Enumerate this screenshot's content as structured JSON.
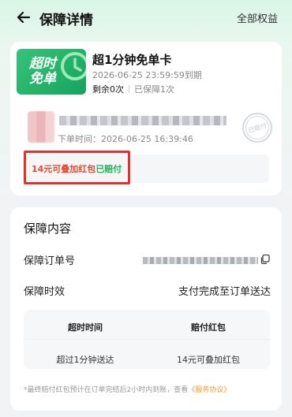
{
  "header": {
    "title": "保障详情",
    "all_benefits": "全部权益"
  },
  "card": {
    "badge_line1": "超时",
    "badge_line2": "免单",
    "name": "超1分钟免单卡",
    "expire": "2026-06-25 23:59:59到期",
    "remaining": "剩余0次",
    "used": "已保障1次"
  },
  "order": {
    "time": "下单时间：2026-06-25 16:39:46",
    "stamp": "已赔付"
  },
  "claim": {
    "amount": "14元可叠加红包",
    "status": "已赔付"
  },
  "guarantee": {
    "section_title": "保障内容",
    "order_no_label": "保障订单号",
    "timeliness_label": "保障时效",
    "timeliness_value": "支付完成至订单送达",
    "table": {
      "headers": [
        "超时时间",
        "赔付红包"
      ],
      "row": [
        "超过1分钟送达",
        "14元可叠加红包"
      ]
    },
    "footnote_prefix": "*最终赔付红包预计在订单完结后2小时内到账，查看",
    "footnote_link": "《服务协议》"
  },
  "colors": {
    "accent_green": "#20b35a",
    "claim_red": "#e34a2f",
    "highlight_border": "#e3312a",
    "link_orange": "#f29b2d"
  }
}
